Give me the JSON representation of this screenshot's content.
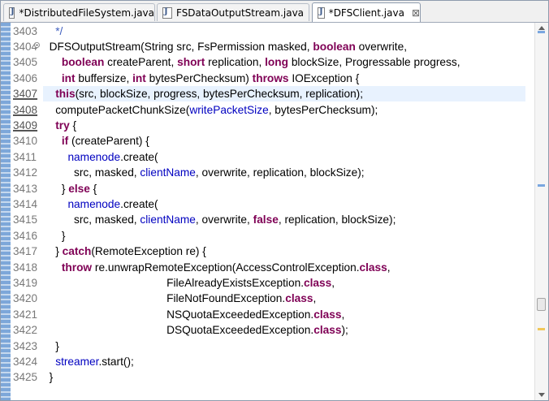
{
  "tabs": [
    {
      "label": "*DistributedFileSystem.java",
      "active": false,
      "closable": false
    },
    {
      "label": "FSDataOutputStream.java",
      "active": false,
      "closable": false
    },
    {
      "label": "*DFSClient.java",
      "active": true,
      "closable": true
    }
  ],
  "tab_close_glyph": "⊠",
  "line_numbers": [
    "3403",
    "3404",
    "3405",
    "3406",
    "3407",
    "3408",
    "3409",
    "3410",
    "3411",
    "3412",
    "3413",
    "3414",
    "3415",
    "3416",
    "3417",
    "3418",
    "3419",
    "3420",
    "3421",
    "3422",
    "3423",
    "3424",
    "3425"
  ],
  "marked_lines": [
    4,
    5,
    6
  ],
  "current_line": 4,
  "code_lines": [
    [
      [
        "c",
        "    */"
      ]
    ],
    [
      [
        "t",
        "  DFSOutputStream(String src, FsPermission masked, "
      ],
      [
        "k",
        "boolean"
      ],
      [
        "t",
        " overwrite,"
      ]
    ],
    [
      [
        "t",
        "      "
      ],
      [
        "k",
        "boolean"
      ],
      [
        "t",
        " createParent, "
      ],
      [
        "k",
        "short"
      ],
      [
        "t",
        " replication, "
      ],
      [
        "k",
        "long"
      ],
      [
        "t",
        " blockSize, Progressable progress,"
      ]
    ],
    [
      [
        "t",
        "      "
      ],
      [
        "k",
        "int"
      ],
      [
        "t",
        " buffersize, "
      ],
      [
        "k",
        "int"
      ],
      [
        "t",
        " bytesPerChecksum) "
      ],
      [
        "k",
        "throws"
      ],
      [
        "t",
        " IOException {"
      ]
    ],
    [
      [
        "t",
        "    "
      ],
      [
        "k",
        "this"
      ],
      [
        "t",
        "(src, blockSize, progress, bytesPerChecksum, replication);"
      ]
    ],
    [
      [
        "t",
        "    computePacketChunkSize("
      ],
      [
        "f",
        "writePacketSize"
      ],
      [
        "t",
        ", bytesPerChecksum);"
      ]
    ],
    [
      [
        "t",
        "    "
      ],
      [
        "k",
        "try"
      ],
      [
        "t",
        " {"
      ]
    ],
    [
      [
        "t",
        "      "
      ],
      [
        "k",
        "if"
      ],
      [
        "t",
        " (createParent) {"
      ]
    ],
    [
      [
        "t",
        "        "
      ],
      [
        "f",
        "namenode"
      ],
      [
        "t",
        ".create("
      ]
    ],
    [
      [
        "t",
        "          src, masked, "
      ],
      [
        "f",
        "clientName"
      ],
      [
        "t",
        ", overwrite, replication, blockSize);"
      ]
    ],
    [
      [
        "t",
        "      } "
      ],
      [
        "k",
        "else"
      ],
      [
        "t",
        " {"
      ]
    ],
    [
      [
        "t",
        "        "
      ],
      [
        "f",
        "namenode"
      ],
      [
        "t",
        ".create("
      ]
    ],
    [
      [
        "t",
        "          src, masked, "
      ],
      [
        "f",
        "clientName"
      ],
      [
        "t",
        ", overwrite, "
      ],
      [
        "k",
        "false"
      ],
      [
        "t",
        ", replication, blockSize);"
      ]
    ],
    [
      [
        "t",
        "      }"
      ]
    ],
    [
      [
        "t",
        "    } "
      ],
      [
        "k",
        "catch"
      ],
      [
        "t",
        "(RemoteException re) {"
      ]
    ],
    [
      [
        "t",
        "      "
      ],
      [
        "k",
        "throw"
      ],
      [
        "t",
        " re.unwrapRemoteException(AccessControlException."
      ],
      [
        "k",
        "class"
      ],
      [
        "t",
        ","
      ]
    ],
    [
      [
        "t",
        "                                        FileAlreadyExistsException."
      ],
      [
        "k",
        "class"
      ],
      [
        "t",
        ","
      ]
    ],
    [
      [
        "t",
        "                                        FileNotFoundException."
      ],
      [
        "k",
        "class"
      ],
      [
        "t",
        ","
      ]
    ],
    [
      [
        "t",
        "                                        NSQuotaExceededException."
      ],
      [
        "k",
        "class"
      ],
      [
        "t",
        ","
      ]
    ],
    [
      [
        "t",
        "                                        DSQuotaExceededException."
      ],
      [
        "k",
        "class"
      ],
      [
        "t",
        ");"
      ]
    ],
    [
      [
        "t",
        "    }"
      ]
    ],
    [
      [
        "t",
        "    "
      ],
      [
        "f",
        "streamer"
      ],
      [
        "t",
        ".start();"
      ]
    ],
    [
      [
        "t",
        "  }"
      ]
    ]
  ],
  "overview_marks": [
    {
      "color": "#7aa7e0"
    },
    {
      "color": "#7aa7e0"
    },
    {
      "color": "#f0c85a"
    }
  ],
  "colors": {
    "keyword": "#7f0055",
    "field": "#0000c0",
    "comment": "#3f5fbf",
    "current_line_bg": "#e8f2fe",
    "ruler": "#7da7d9"
  }
}
